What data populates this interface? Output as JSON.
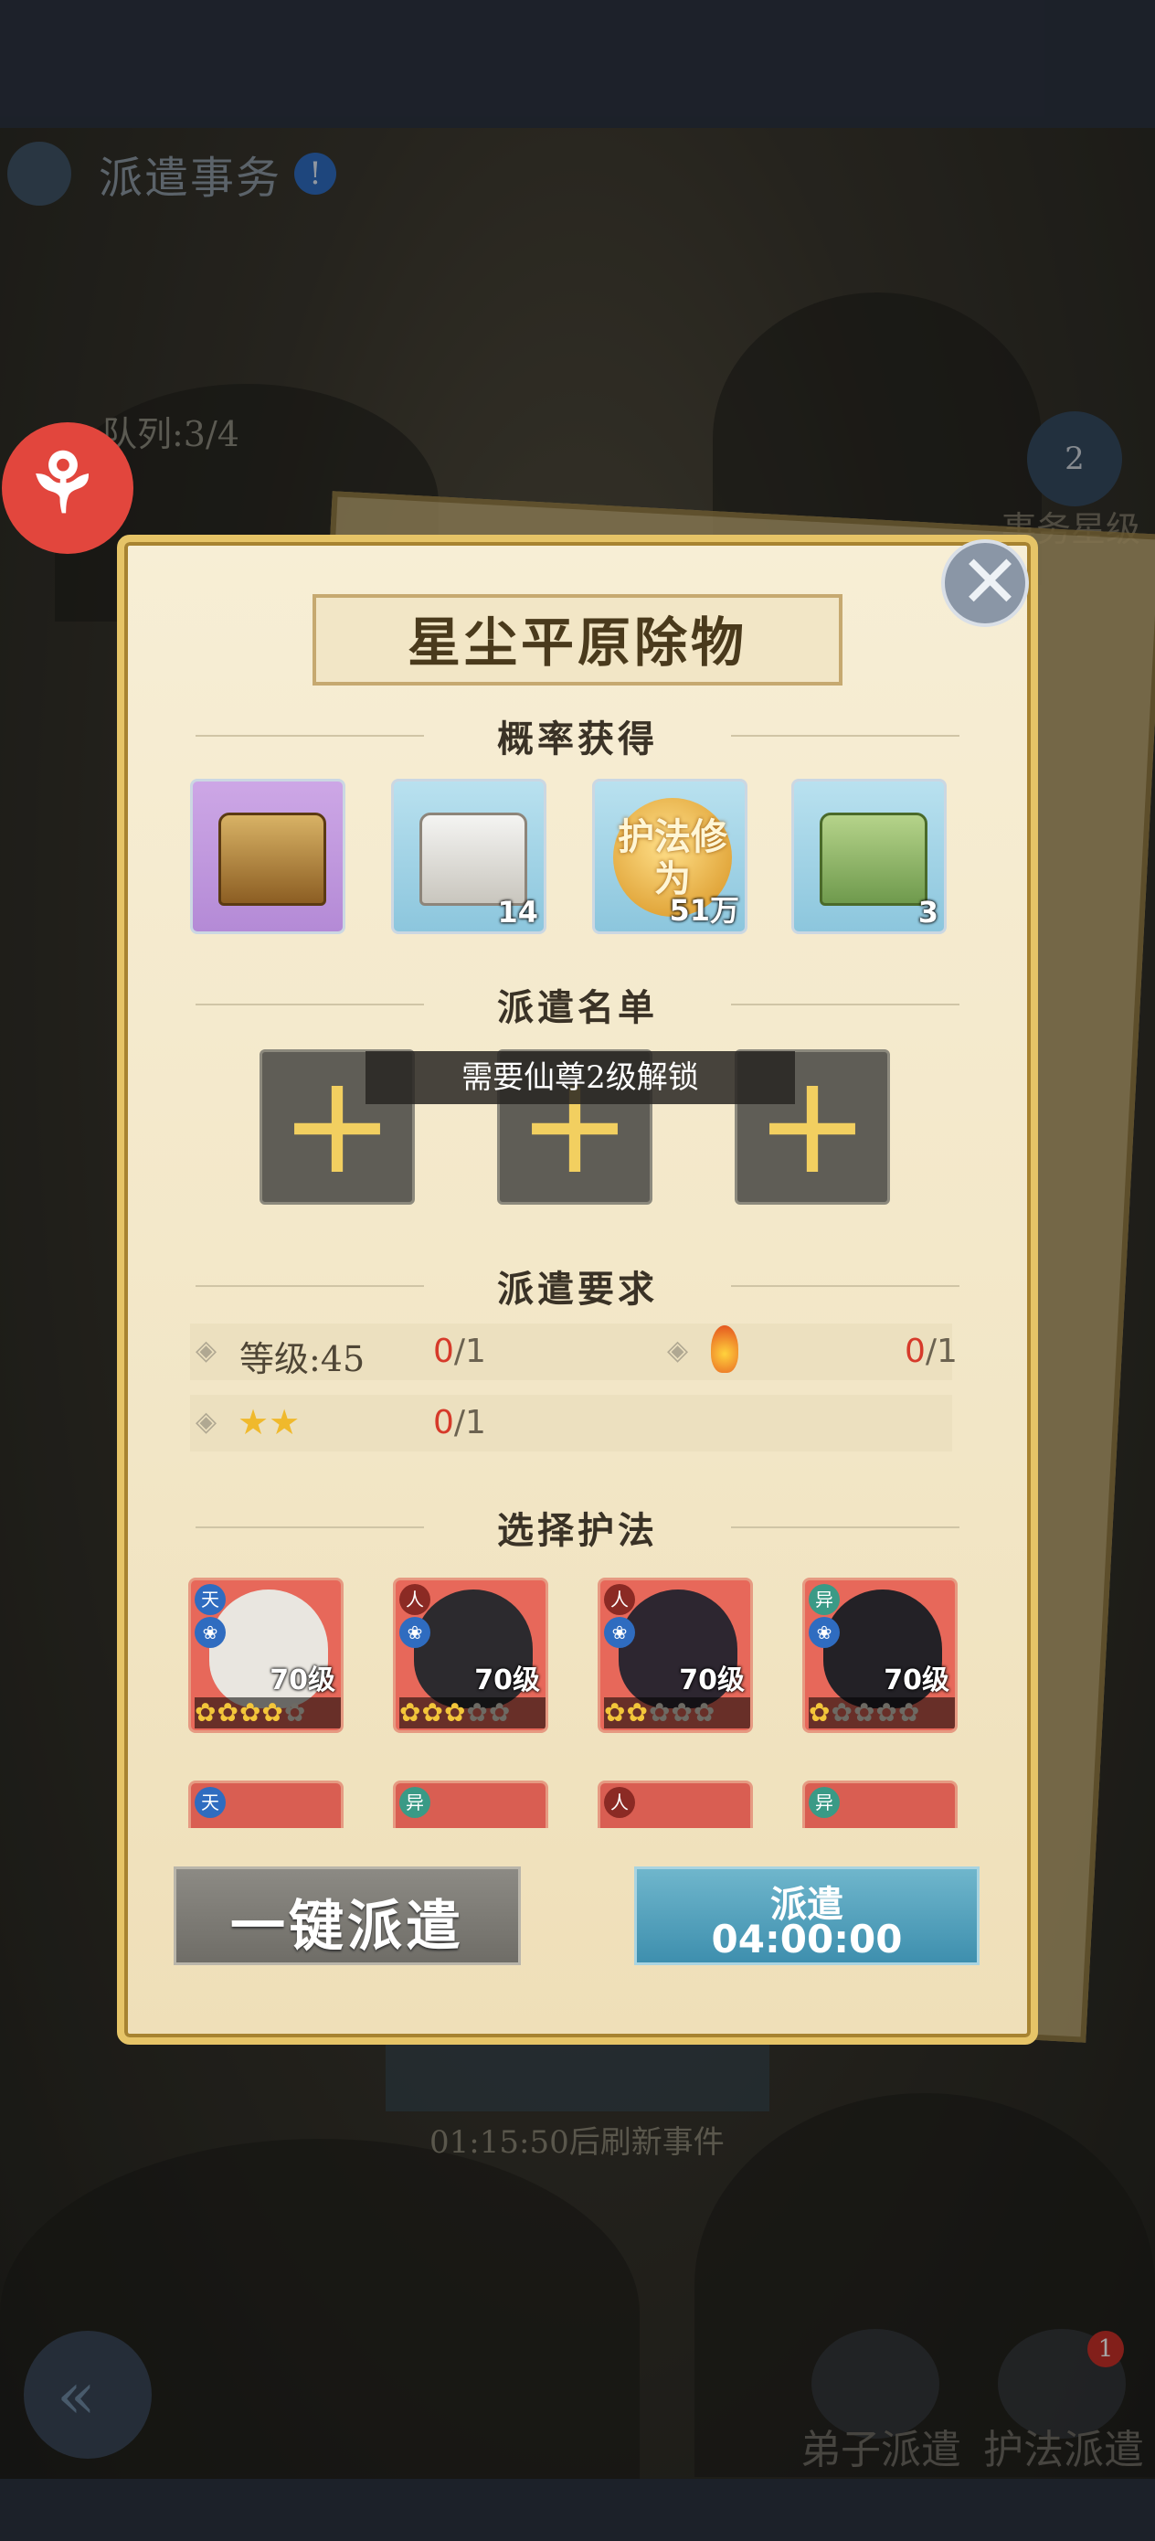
{
  "background": {
    "page_title": "派遣事务",
    "alert_mark": "!",
    "queue": "队列:3/4",
    "star_badge_count": "2",
    "star_level_label": "事务星级",
    "refresh_text": "01:15:50后刷新事件",
    "bottom_nav": [
      {
        "label": "弟子派遣"
      },
      {
        "label": "护法派遣",
        "badge": "1"
      }
    ]
  },
  "modal": {
    "title": "星尘平原除物",
    "close_glyph": "✕",
    "sections": {
      "rewards": "概率获得",
      "roster": "派遣名单",
      "requirements": "派遣要求",
      "select": "选择护法"
    },
    "rewards": [
      {
        "icon": "gold-treasure-chest-icon",
        "qty": ""
      },
      {
        "icon": "silver-chest-icon",
        "qty": "14"
      },
      {
        "icon": "protector-cultivation-coin-icon",
        "coin_text": "护法修为",
        "qty": "51万"
      },
      {
        "icon": "jade-chest-icon",
        "qty": "3"
      }
    ],
    "roster": {
      "lock_text": "需要仙尊2级解锁",
      "slot_glyph": "+"
    },
    "requirements": [
      {
        "label": "等级:45",
        "have": "0",
        "need": "/1"
      },
      {
        "label": "",
        "icon": "fire-element-icon",
        "have": "0",
        "need": "/1"
      },
      {
        "label": "★★",
        "have": "0",
        "need": "/1"
      }
    ],
    "heroes": [
      {
        "faction": "天",
        "level": "70级",
        "stars_on": 4
      },
      {
        "faction": "人",
        "level": "70级",
        "stars_on": 3
      },
      {
        "faction": "人",
        "level": "70级",
        "stars_on": 2
      },
      {
        "faction": "异",
        "level": "70级",
        "stars_on": 1
      }
    ],
    "heroes_row2_factions": [
      "天",
      "异",
      "人",
      "异"
    ],
    "buttons": {
      "one_click": "一键派遣",
      "dispatch": "派遣",
      "timer": "04:00:00"
    }
  },
  "colors": {
    "accent_gold": "#e6c467",
    "red_count": "#d63a2a",
    "dispatch_blue": "#3e8fae"
  }
}
